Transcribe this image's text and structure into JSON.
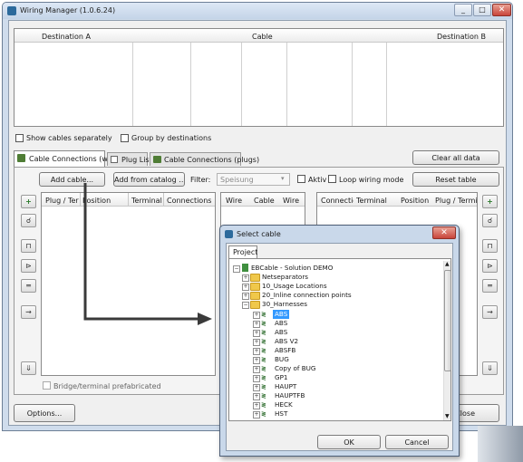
{
  "window": {
    "title": "Wiring Manager (1.0.6.24)"
  },
  "top_table": {
    "columns": [
      "Destination A",
      "Cable",
      "Destination B"
    ]
  },
  "options": {
    "show_cables_separately": "Show cables separately",
    "group_by_destinations": "Group by destinations"
  },
  "tabs": [
    "Cable Connections (wires)",
    "Plug List",
    "Cable Connections (plugs)"
  ],
  "toolbar": {
    "add_cable": "Add cable...",
    "add_from_catalog": "Add from catalog ...",
    "filter_label": "Filter:",
    "filter_value": "Speisung",
    "aktiv": "Aktiv",
    "loop_wiring_mode": "Loop wiring mode",
    "clear_all_data": "Clear all data",
    "reset_table": "Reset table"
  },
  "left_table": {
    "columns": [
      "Plug / Ter",
      "Position",
      "Terminal",
      "Connections"
    ]
  },
  "mid_table": {
    "columns": [
      "Wire",
      "Cable",
      "Wire"
    ]
  },
  "right_table": {
    "columns": [
      "Connectio",
      "Terminal",
      "Position",
      "Plug / Termin"
    ]
  },
  "bridge_prefab": "Bridge/terminal prefabricated",
  "buttons": {
    "options": "Options...",
    "close": "Close"
  },
  "dialog": {
    "title": "Select cable",
    "tab": "Project",
    "root": "EBCable - Solution DEMO",
    "folders": [
      "Netseparators",
      "10_Usage Locations",
      "20_Inline connection points",
      "30_Harnesses"
    ],
    "cables": [
      "ABS",
      "ABS",
      "ABS",
      "ABS V2",
      "ABSFB",
      "BUG",
      "Copy of BUG",
      "GP1",
      "HAUPT",
      "HAUPTFB",
      "HECK",
      "HST"
    ],
    "selected_index": 0,
    "ok": "OK",
    "cancel": "Cancel"
  },
  "colors": {
    "selection": "#3399ff",
    "arrow": "#3a3a3a",
    "chrome": "#cfdcec",
    "close_button": "#c9453b"
  }
}
